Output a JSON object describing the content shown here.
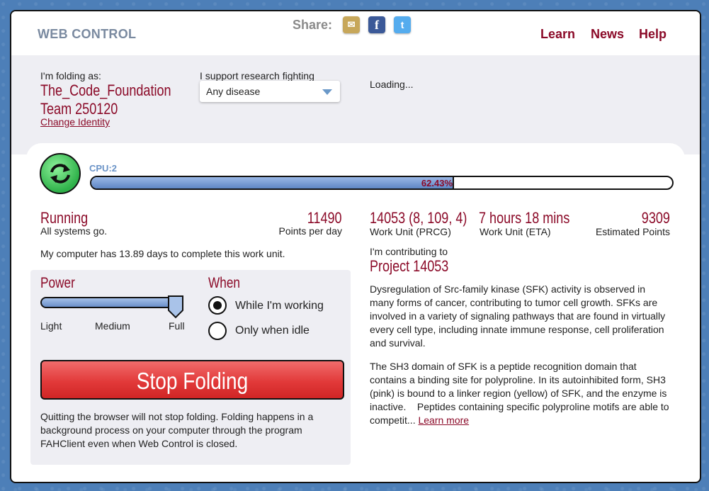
{
  "header": {
    "brand": "WEB CONTROL",
    "share_label": "Share:",
    "share_icons": [
      "mail-icon",
      "facebook-icon",
      "twitter-icon"
    ],
    "nav": {
      "learn": "Learn",
      "news": "News",
      "help": "Help"
    }
  },
  "identity": {
    "folding_as_label": "I'm folding as:",
    "name": "The_Code_Foundation",
    "team": "Team 250120",
    "change_identity": "Change Identity",
    "cause_label": "I support research fighting",
    "cause_value": "Any disease",
    "status_text": "Loading..."
  },
  "slot": {
    "cpu_label": "CPU:2",
    "progress_text": "62.43%",
    "progress_fraction": 0.6243
  },
  "status": {
    "state": "Running",
    "state_sub": "All systems go.",
    "ppd": "11490",
    "ppd_label": "Points per day",
    "days_text": "My computer has 13.89 days to complete this work unit."
  },
  "work_unit": {
    "prcg": "14053 (8, 109, 4)",
    "prcg_label": "Work Unit (PRCG)",
    "eta": "7 hours 18 mins",
    "eta_label": "Work Unit (ETA)",
    "points": "9309",
    "points_label": "Estimated Points",
    "contributing_label": "I'm contributing to",
    "project": "Project 14053",
    "desc1_lines": [
      "Dysregulation of Src-family kinase (SFK) activity is observed in",
      "many forms of cancer, contributing to tumor cell growth. SFKs are",
      "involved in a variety of signaling pathways that are found in virtually",
      "every cell type, including innate immune response, cell proliferation",
      "and survival."
    ],
    "desc2_lines": [
      "The SH3 domain of SFK is a peptide recognition domain that",
      "contains a binding site for polyproline. In its autoinhibited form, SH3",
      "(pink) is bound to a linker region (yellow) of SFK, and the enzyme is",
      "inactive.    Peptides containing specific polyproline motifs are able to"
    ],
    "desc2_last": "competit...",
    "learn_more": "Learn more"
  },
  "controls": {
    "power_title": "Power",
    "power_levels": [
      "Light",
      "Medium",
      "Full"
    ],
    "power_selected": "Full",
    "when_title": "When",
    "when_options": [
      "While I'm working",
      "Only when idle"
    ],
    "when_selected": "While I'm working",
    "stop_button": "Stop Folding",
    "quit_note_lines": [
      "Quitting the browser will not stop folding. Folding happens in a",
      "background process on your computer through the program",
      "FAHClient even when Web Control is closed."
    ]
  },
  "colors": {
    "accent": "#8b0a28",
    "progress_blue": "#6b90c9",
    "stop_red": "#e23a3a",
    "refresh_green": "#2fb14a"
  }
}
